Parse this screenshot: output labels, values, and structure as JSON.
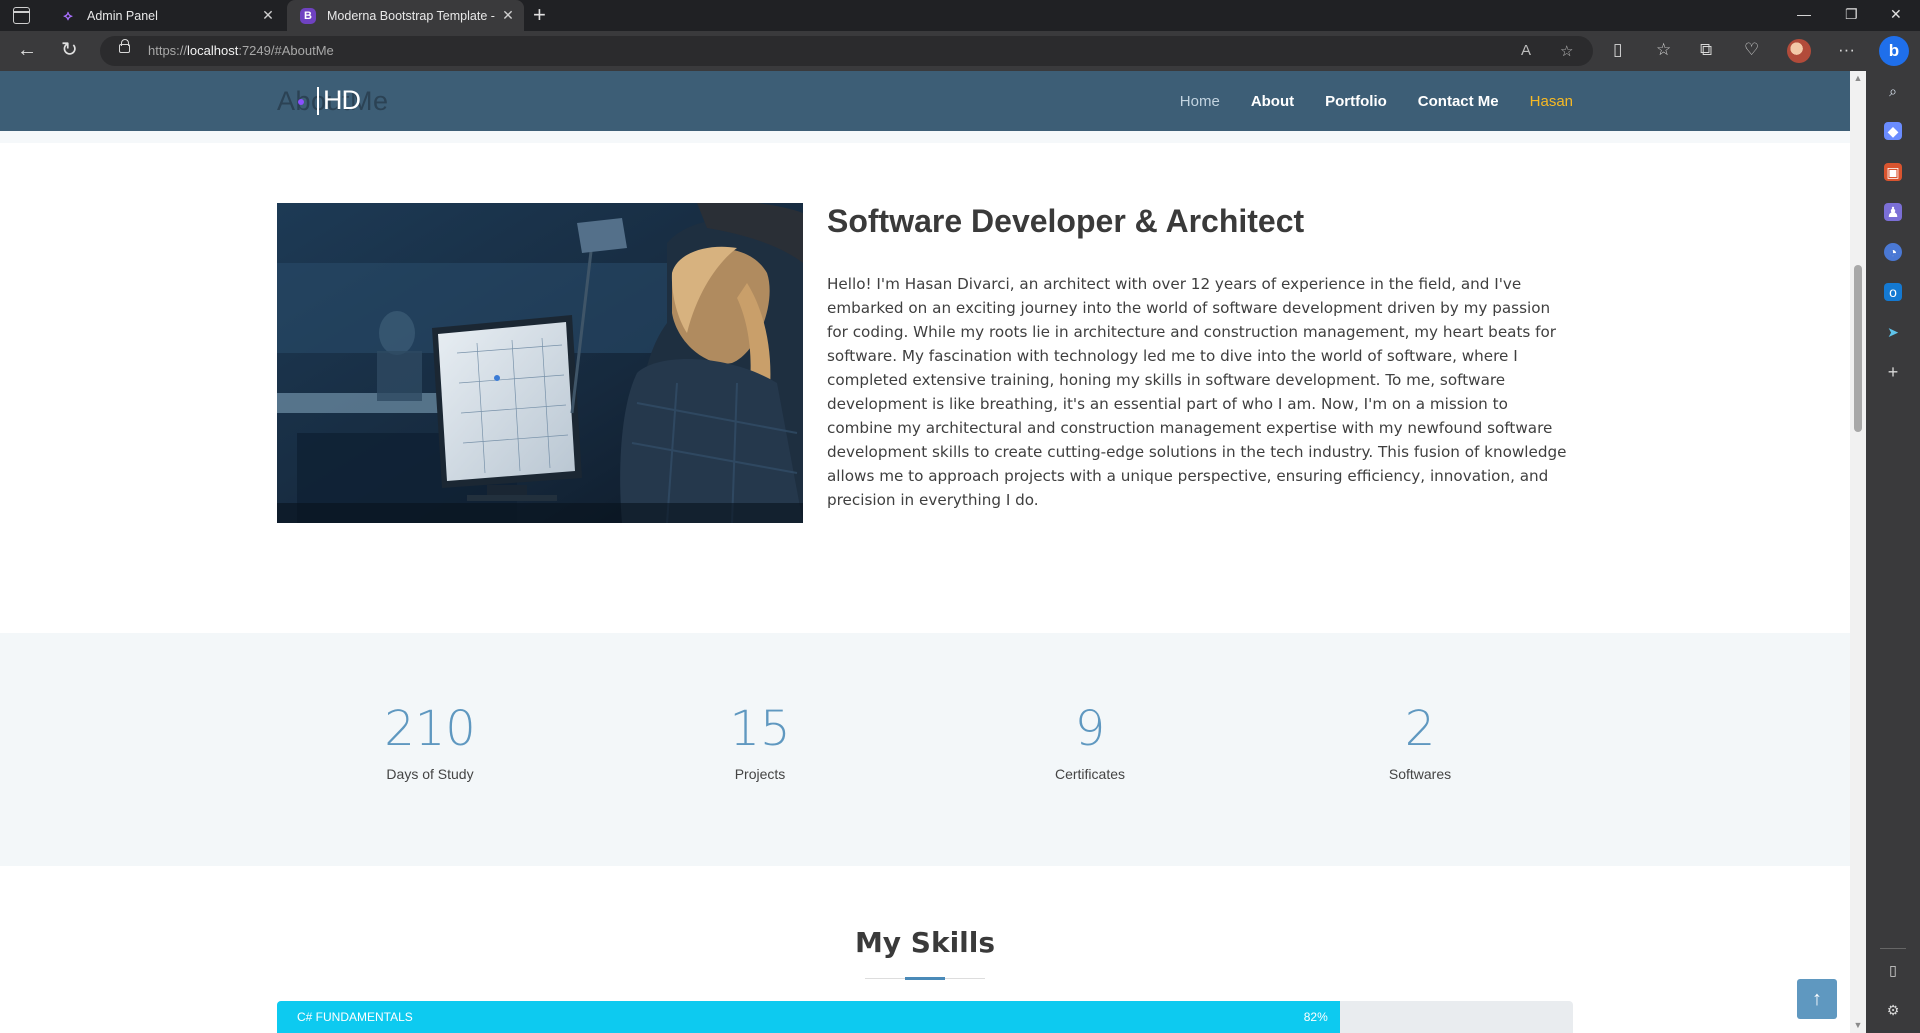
{
  "browser": {
    "tabs": [
      {
        "title": "Admin Panel",
        "active": false
      },
      {
        "title": "Moderna Bootstrap Template - I",
        "active": true
      }
    ],
    "url_prefix": "https://",
    "url_host": "localhost",
    "url_rest": ":7249/#AboutMe"
  },
  "site": {
    "logo_ghost_text": "AboutMe",
    "logo_text": "HD",
    "nav": [
      "Home",
      "About",
      "Portfolio",
      "Contact Me",
      "Hasan"
    ]
  },
  "about": {
    "title": "Software Developer & Architect",
    "text": "Hello! I'm Hasan Divarci, an architect with over 12 years of experience in the field, and I've embarked on an exciting journey into the world of software development driven by my passion for coding. While my roots lie in architecture and construction management, my heart beats for software. My fascination with technology led me to dive into the world of software, where I completed extensive training, honing my skills in software development. To me, software development is like breathing, it's an essential part of who I am. Now, I'm on a mission to combine my architectural and construction management expertise with my newfound software development skills to create cutting-edge solutions in the tech industry. This fusion of knowledge allows me to approach projects with a unique perspective, ensuring efficiency, innovation, and precision in everything I do."
  },
  "counts": [
    {
      "value": "210",
      "label": "Days of Study"
    },
    {
      "value": "15",
      "label": "Projects"
    },
    {
      "value": "9",
      "label": "Certificates"
    },
    {
      "value": "2",
      "label": "Softwares"
    }
  ],
  "skills": {
    "title": "My Skills",
    "items": [
      {
        "name": "C# FUNDAMENTALS",
        "percent_label": "82%",
        "percent": 82
      }
    ]
  },
  "colors": {
    "header": "#3d5e76",
    "accent": "#5f98c0",
    "skill_fill": "#0dcaf0",
    "nav_highlight": "#f7b924"
  }
}
